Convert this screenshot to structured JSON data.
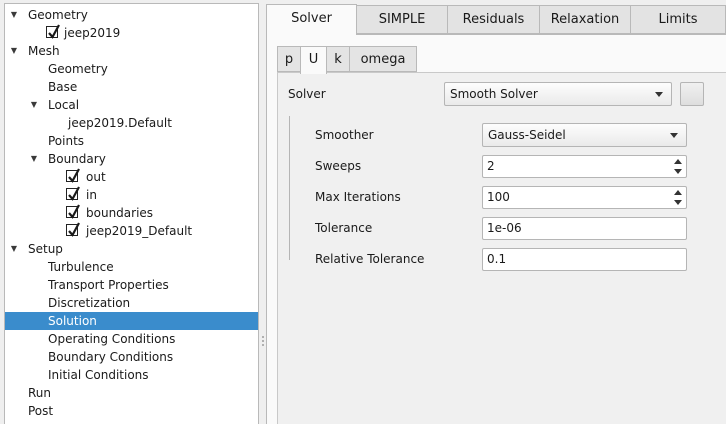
{
  "tree": {
    "items": [
      {
        "label": "Geometry",
        "arrow": "▼"
      },
      {
        "label": "jeep2019",
        "checked": true
      },
      {
        "label": "Mesh",
        "arrow": "▼"
      },
      {
        "label": "Geometry"
      },
      {
        "label": "Base"
      },
      {
        "label": "Local",
        "arrow": "▼"
      },
      {
        "label": "jeep2019.Default"
      },
      {
        "label": "Points"
      },
      {
        "label": "Boundary",
        "arrow": "▼"
      },
      {
        "label": "out",
        "checked": true
      },
      {
        "label": "in",
        "checked": true
      },
      {
        "label": "boundaries",
        "checked": true
      },
      {
        "label": "jeep2019_Default",
        "checked": true
      },
      {
        "label": "Setup",
        "arrow": "▼"
      },
      {
        "label": "Turbulence"
      },
      {
        "label": "Transport Properties"
      },
      {
        "label": "Discretization"
      },
      {
        "label": "Solution",
        "selected": true
      },
      {
        "label": "Operating Conditions"
      },
      {
        "label": "Boundary Conditions"
      },
      {
        "label": "Initial Conditions"
      },
      {
        "label": "Run"
      },
      {
        "label": "Post"
      }
    ]
  },
  "tabs": [
    {
      "label": "Solver",
      "active": true
    },
    {
      "label": "SIMPLE"
    },
    {
      "label": "Residuals"
    },
    {
      "label": "Relaxation"
    },
    {
      "label": "Limits"
    }
  ],
  "subtabs": [
    {
      "label": "p"
    },
    {
      "label": "U",
      "active": true
    },
    {
      "label": "k"
    },
    {
      "label": "omega"
    }
  ],
  "form": {
    "solver_label": "Solver",
    "solver_value": "Smooth Solver",
    "smoother_label": "Smoother",
    "smoother_value": "Gauss-Seidel",
    "sweeps_label": "Sweeps",
    "sweeps_value": "2",
    "max_iter_label": "Max Iterations",
    "max_iter_value": "100",
    "tolerance_label": "Tolerance",
    "tolerance_value": "1e-06",
    "rel_tol_label": "Relative Tolerance",
    "rel_tol_value": "0.1"
  },
  "colors": {
    "selection": "#3a8ccc"
  }
}
